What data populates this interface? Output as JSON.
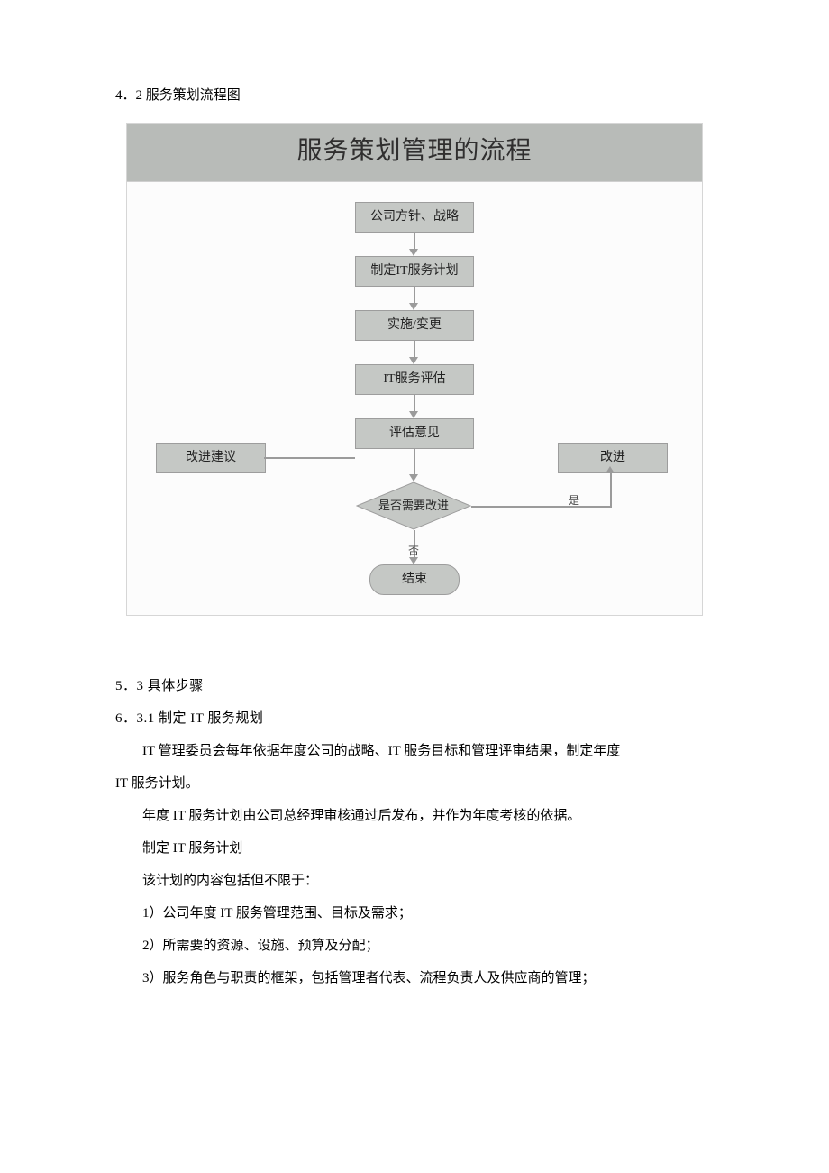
{
  "section1": {
    "heading": "4．2 服务策划流程图"
  },
  "flowchart": {
    "title": "服务策划管理的流程",
    "nodes": {
      "policy": "公司方针、战略",
      "plan": "制定IT服务计划",
      "implement": "实施/变更",
      "evaluate": "IT服务评估",
      "opinion": "评估意见",
      "suggestion": "改进建议",
      "improve": "改进",
      "decision": "是否需要改进",
      "yes": "是",
      "no": "否",
      "end": "结束"
    }
  },
  "section2": {
    "heading": "5．3 具体步骤"
  },
  "section3": {
    "heading": "6．3.1 制定 IT 服务规划"
  },
  "paragraphs": {
    "p1": "IT 管理委员会每年依据年度公司的战略、IT 服务目标和管理评审结果，制定年度",
    "p1b": "IT 服务计划。",
    "p2": "年度 IT 服务计划由公司总经理审核通过后发布，并作为年度考核的依据。",
    "p3": "制定 IT 服务计划",
    "p4": "该计划的内容包括但不限于：",
    "p5": "1）公司年度 IT 服务管理范围、目标及需求；",
    "p6": "2）所需要的资源、设施、预算及分配；",
    "p7": "3）服务角色与职责的框架，包括管理者代表、流程负责人及供应商的管理；"
  }
}
